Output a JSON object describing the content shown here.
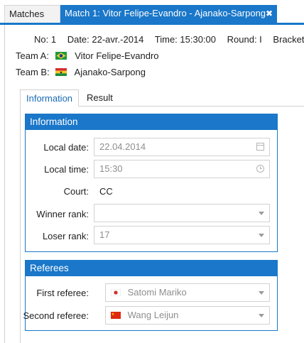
{
  "tabs": {
    "matches": "Matches",
    "match": "Match 1: Vitor Felipe-Evandro - Ajanako-Sarpong",
    "close_glyph": "✖"
  },
  "header": {
    "no": "No: 1",
    "date": "Date: 22-avr.-2014",
    "time": "Time: 15:30:00",
    "round": "Round: I",
    "bracket": "Bracket:"
  },
  "team_a": {
    "label": "Team A:",
    "name": "Vitor Felipe-Evandro",
    "flag": "brazil-flag"
  },
  "team_b": {
    "label": "Team B:",
    "name": "Ajanako-Sarpong",
    "flag": "ghana-flag"
  },
  "inner_tabs": {
    "information": "Information",
    "result": "Result"
  },
  "information": {
    "title": "Information",
    "local_date_label": "Local date:",
    "local_date": "22.04.2014",
    "local_time_label": "Local time:",
    "local_time": "15:30",
    "court_label": "Court:",
    "court": "CC",
    "winner_rank_label": "Winner rank:",
    "winner_rank": "",
    "loser_rank_label": "Loser rank:",
    "loser_rank": "17"
  },
  "referees": {
    "title": "Referees",
    "first_label": "First referee:",
    "first": "Satomi Mariko",
    "first_flag": "japan-flag",
    "second_label": "Second referee:",
    "second": "Wang Leijun",
    "second_flag": "china-flag"
  },
  "colors": {
    "accent": "#1a77c9",
    "label_text": "#1e1e1e",
    "disabled_text": "#8e8e8e"
  }
}
